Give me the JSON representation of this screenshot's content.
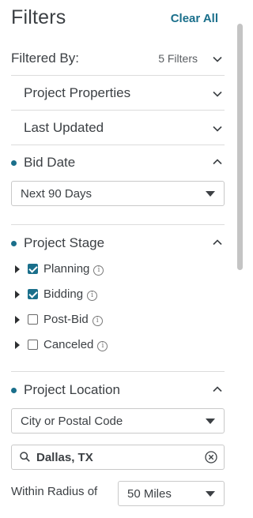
{
  "header": {
    "title": "Filters",
    "clear_all": "Clear All"
  },
  "filtered_by": {
    "label": "Filtered By:",
    "count": "5 Filters"
  },
  "sections": {
    "project_properties": "Project Properties",
    "last_updated": "Last Updated",
    "bid_date": {
      "label": "Bid Date",
      "selected": "Next 90 Days"
    },
    "project_stage": {
      "label": "Project Stage",
      "items": [
        {
          "label": "Planning",
          "checked": true
        },
        {
          "label": "Bidding",
          "checked": true
        },
        {
          "label": "Post-Bid",
          "checked": false
        },
        {
          "label": "Canceled",
          "checked": false
        }
      ]
    },
    "project_location": {
      "label": "Project Location",
      "type_selected": "City or Postal Code",
      "search_value": "Dallas, TX",
      "radius_label": "Within Radius of",
      "radius_selected": "50 Miles"
    }
  },
  "colors": {
    "accent": "#1a6f8b",
    "text": "#3c4044",
    "divider": "#dcdcdc"
  },
  "icons": {
    "chevron_down": "chevron-down-icon",
    "chevron_up": "chevron-up-icon",
    "info": "info-icon",
    "search": "search-icon",
    "clear": "clear-circle-icon",
    "expand": "expand-triangle-icon"
  }
}
